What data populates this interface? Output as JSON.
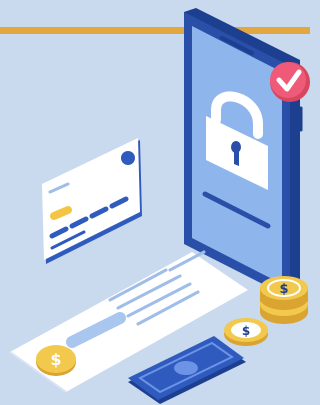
{
  "illustration": {
    "subject": "mobile-payment-security",
    "icons": {
      "phone": "smartphone-icon",
      "lock": "padlock-icon",
      "check": "checkmark-badge-icon",
      "card": "credit-card-icon",
      "receipt": "receipt-icon",
      "coin": "coin-icon",
      "banknote": "banknote-icon"
    },
    "glyphs": {
      "coin_symbol": "$"
    },
    "colors": {
      "background": "#c9d9ee",
      "accent_bar": "#e3a73f",
      "phone_body": "#2a4fa8",
      "phone_screen": "#8fb6ec",
      "lock": "#ffffff",
      "check_badge": "#ef5a78",
      "card": "#ffffff",
      "card_chip": "#f3c542",
      "card_stripes": "#2f5bbf",
      "receipt": "#ffffff",
      "coin": "#f2c94c",
      "coin_dark": "#d9a430",
      "banknote": "#2f5bbf",
      "banknote_light": "#6c93e6"
    }
  }
}
